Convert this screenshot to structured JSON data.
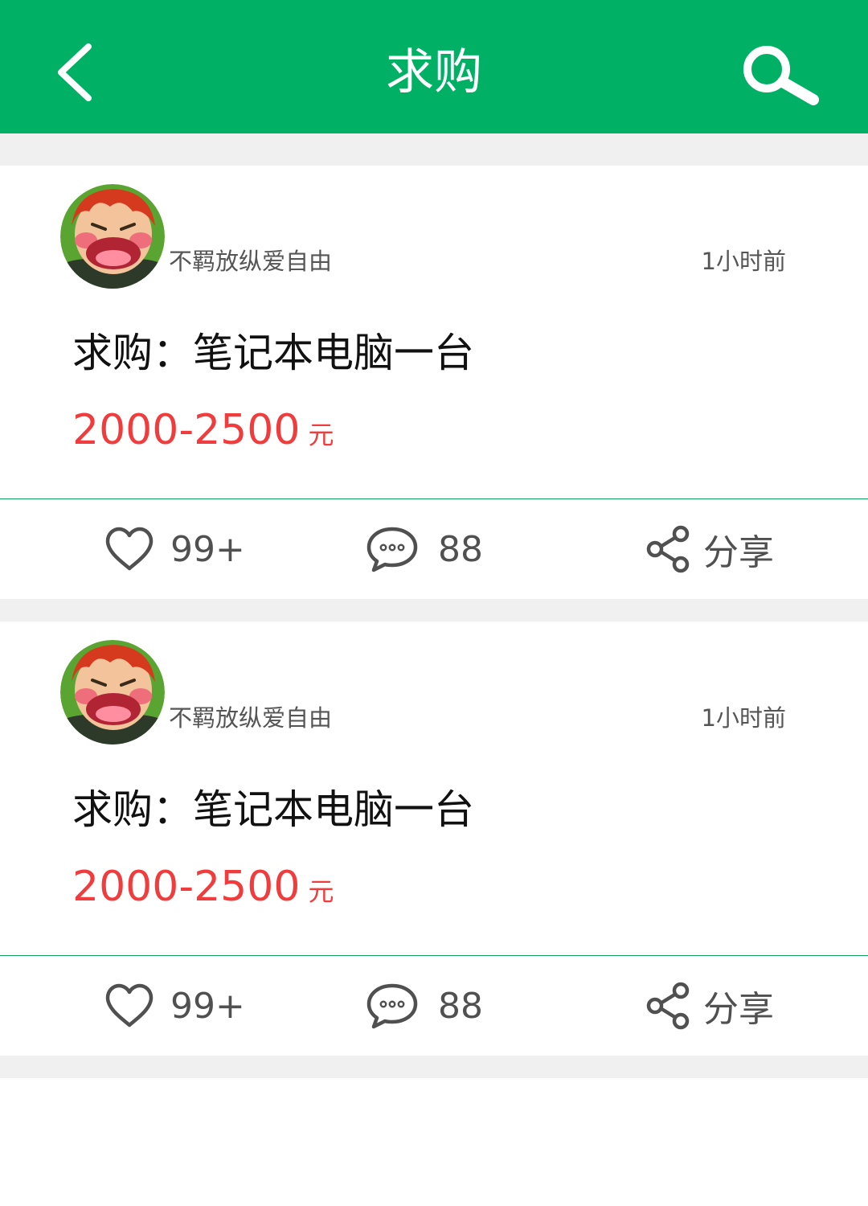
{
  "header": {
    "title": "求购",
    "back_icon": "chevron-left-icon",
    "search_icon": "search-icon",
    "background": "#00b065"
  },
  "posts": [
    {
      "username": "不羁放纵爱自由",
      "time": "1小时前",
      "title": "求购：笔记本电脑一台",
      "price": "2000-2500",
      "unit": "元",
      "likes": "99+",
      "comments": "88",
      "share": "分享"
    },
    {
      "username": "不羁放纵爱自由",
      "time": "1小时前",
      "title": "求购：笔记本电脑一台",
      "price": "2000-2500",
      "unit": "元",
      "likes": "99+",
      "comments": "88",
      "share": "分享"
    }
  ],
  "colors": {
    "accent": "#00b065",
    "price": "#f03c3c",
    "divider": "#13a05e",
    "gap": "#f0f0f0"
  }
}
